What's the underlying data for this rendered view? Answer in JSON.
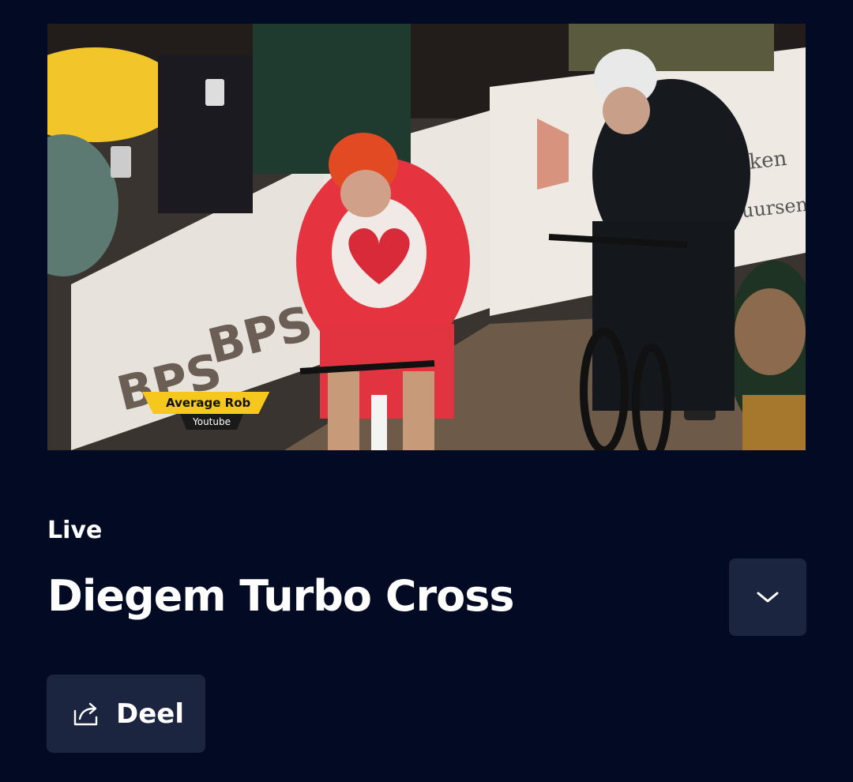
{
  "video": {
    "description_icon": "video-player",
    "lower_third": {
      "name": "Average Rob",
      "subtitle": "Youtube"
    }
  },
  "stream": {
    "status_label": "Live",
    "title": "Diegem Turbo Cross"
  },
  "actions": {
    "expand_icon": "chevron-down-icon",
    "share_icon": "share-icon",
    "share_label": "Deel"
  },
  "colors": {
    "background": "#030b24",
    "button_background": "#1c2540",
    "lower_third_accent": "#f6c81d"
  }
}
